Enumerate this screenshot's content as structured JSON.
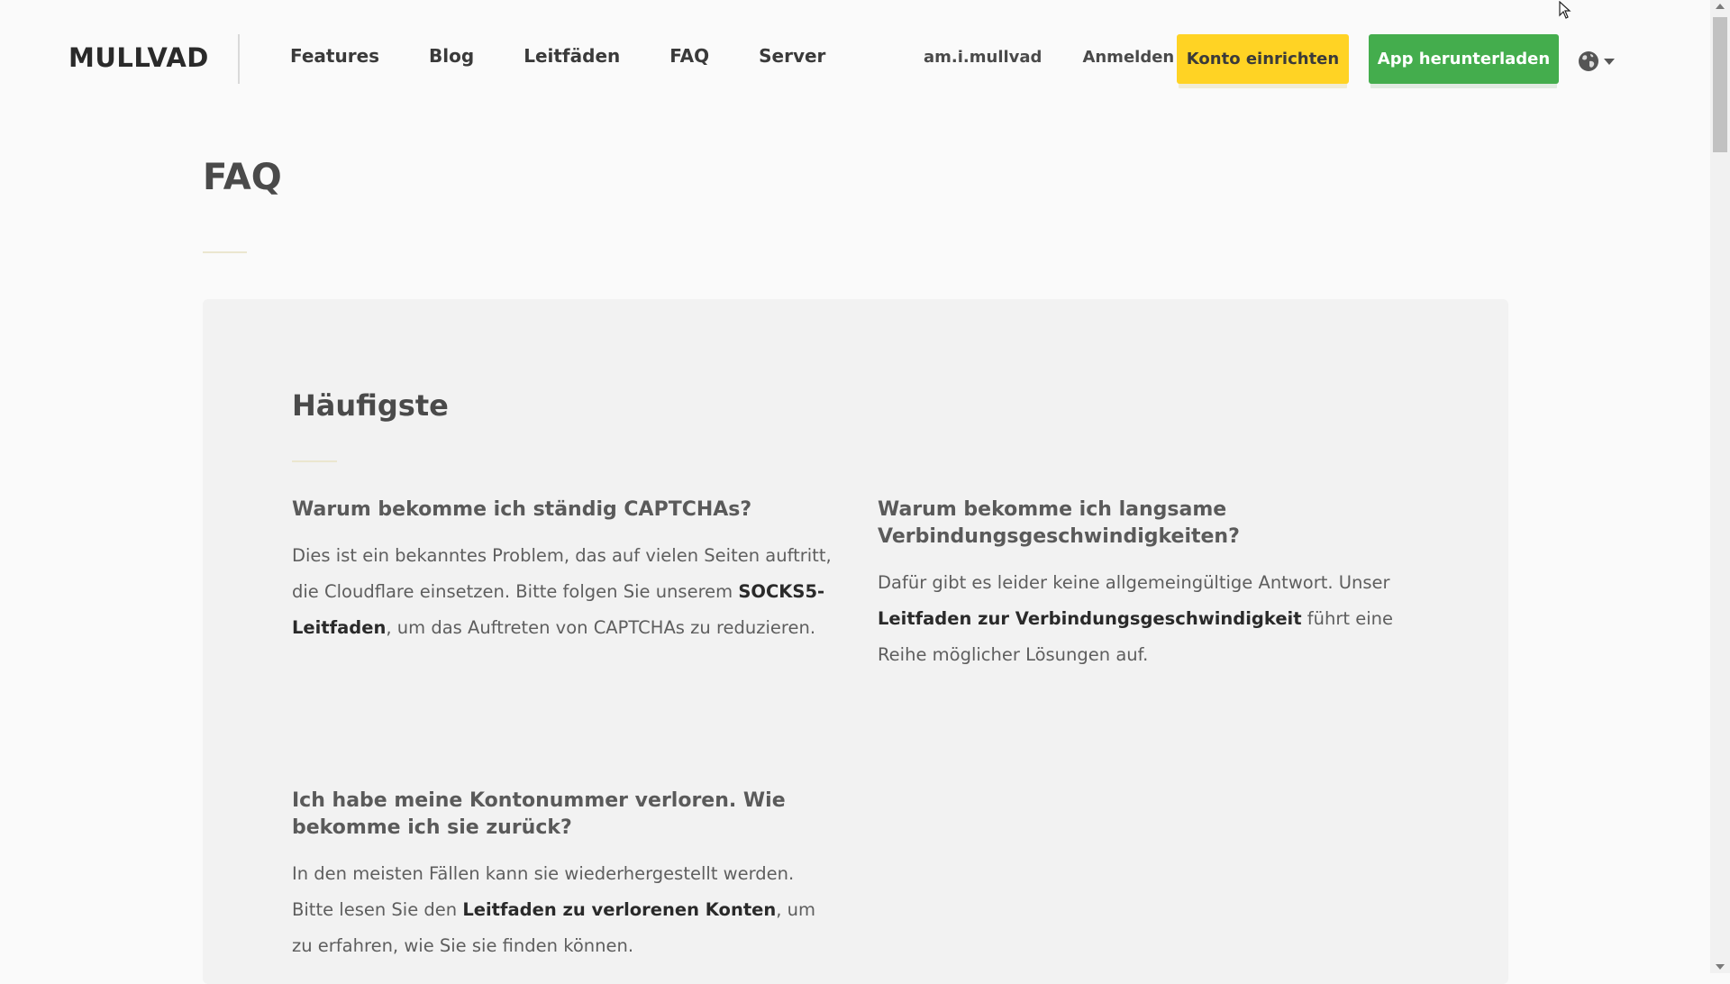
{
  "header": {
    "logo": "MULLVAD",
    "nav": [
      "Features",
      "Blog",
      "Leitfäden",
      "FAQ",
      "Server"
    ],
    "check_link": "am.i.mullvad",
    "login_link": "Anmelden",
    "create_account_button": "Konto einrichten",
    "download_button": "App herunterladen",
    "language_icon": "globe-icon"
  },
  "colors": {
    "yellow_button": "#ffd324",
    "green_button": "#44ad4d",
    "card_background": "#f2f2f2",
    "page_background": "#fafafa"
  },
  "page": {
    "title": "FAQ"
  },
  "faq": {
    "section_title": "Häufigste",
    "items": [
      {
        "question": "Warum bekomme ich ständig CAPTCHAs?",
        "answer_before": "Dies ist ein bekanntes Problem, das auf vielen Seiten auftritt, die Cloudflare einsetzen. Bitte folgen Sie unserem ",
        "answer_link": "SOCKS5-Leitfaden",
        "answer_after": ", um das Auftreten von CAPTCHAs zu reduzieren."
      },
      {
        "question": "Warum bekomme ich langsame Verbindungsgeschwindigkeiten?",
        "answer_before": "Dafür gibt es leider keine allgemeingültige Antwort. Unser ",
        "answer_link": "Leitfaden zur Verbindungsgeschwindigkeit",
        "answer_after": " führt eine Reihe möglicher Lösungen auf."
      },
      {
        "question": "Ich habe meine Kontonummer verloren. Wie bekomme ich sie zurück?",
        "answer_before": "In den meisten Fällen kann sie wiederhergestellt werden. Bitte lesen Sie den ",
        "answer_link": "Leitfaden zu verlorenen Konten",
        "answer_after": ", um zu erfahren, wie Sie sie finden können."
      }
    ]
  }
}
